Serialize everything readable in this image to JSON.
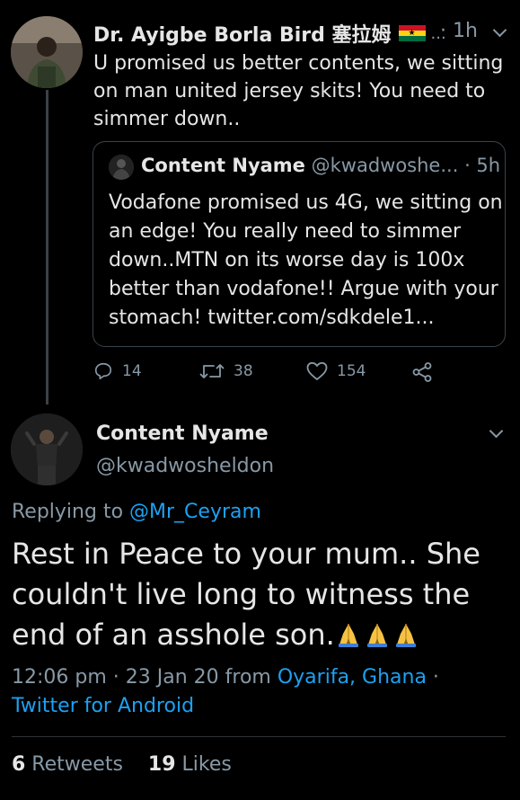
{
  "first_tweet": {
    "display_name": "Dr. Ayigbe Borla Bird 塞拉姆",
    "ellipsis": "...",
    "time": "· 1h",
    "flag_colors": [
      "#ce1126",
      "#fcd116",
      "#006b3f"
    ],
    "text": "U promised us better contents, we sitting on man united jersey skits! You need to simmer down..",
    "quoted": {
      "display_name": "Content Nyame",
      "handle": "@kwadwoshe...",
      "time": "· 5h",
      "text": "Vodafone promised us 4G, we sitting on an edge! You really need to simmer down..MTN on its worse day is 100x better than vodafone!! Argue with your stomach! twitter.com/sdkdele1..."
    },
    "actions": {
      "reply_count": "14",
      "retweet_count": "38",
      "like_count": "154"
    }
  },
  "main_tweet": {
    "display_name": "Content Nyame",
    "handle": "@kwadwosheldon",
    "replying_prefix": "Replying to ",
    "replying_to": "@Mr_Ceyram",
    "text": "Rest in Peace to your mum.. She couldn't live long to witness the end of an asshole son.",
    "emoji": "folded-hands ×3",
    "timestamp": "12:06 pm · 23 Jan 20 from ",
    "location": "Oyarifa, Ghana",
    "separator": " · ",
    "source": "Twitter for Android",
    "retweets_count": "6",
    "retweets_label": " Retweets",
    "likes_count": "19",
    "likes_label": " Likes"
  },
  "colors": {
    "background": "#000000",
    "text": "#e6e6e6",
    "secondary": "#8899a6",
    "link": "#1da1f2"
  },
  "icons": [
    "reply-icon",
    "retweet-icon",
    "like-icon",
    "share-icon",
    "chevron-down-icon"
  ]
}
